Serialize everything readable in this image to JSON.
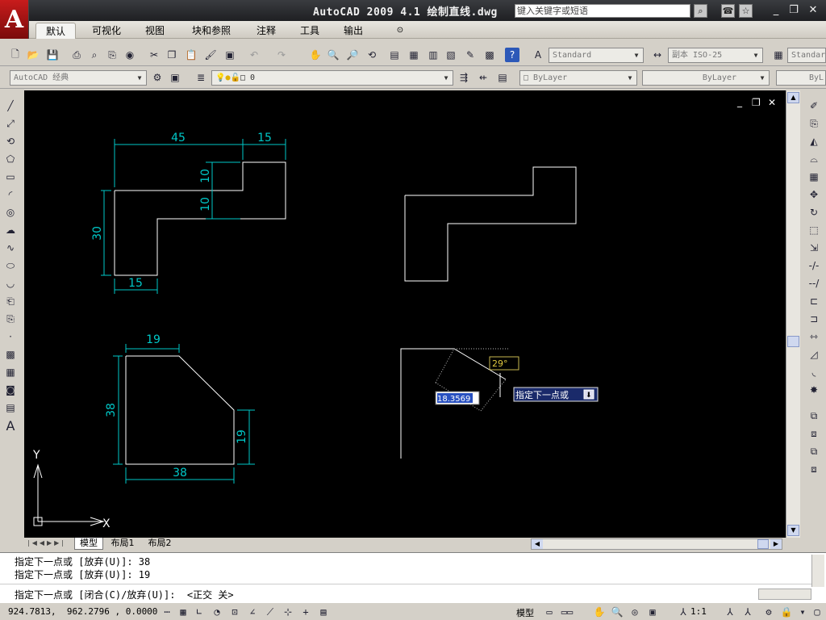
{
  "window": {
    "title": "AutoCAD 2009 4.1 绘制直线.dwg",
    "logo_letter": "A",
    "search_placeholder": "键入关键字或短语",
    "minimize": "_",
    "restore": "❐",
    "close": "✕"
  },
  "ribbon_tabs": [
    {
      "label": "默认",
      "active": true
    },
    {
      "label": "可视化",
      "active": false
    },
    {
      "label": "视图",
      "active": false
    },
    {
      "label": "块和参照",
      "active": false
    },
    {
      "label": "注释",
      "active": false
    },
    {
      "label": "工具",
      "active": false
    },
    {
      "label": "输出",
      "active": false
    }
  ],
  "toolbar": {
    "text_style": "Standard",
    "dim_style": "副本 ISO-25",
    "table_style": "Standar",
    "workspace": "AutoCAD 经典",
    "layer": "0",
    "color": "ByLayer",
    "linetype": "ByLayer",
    "lineweight": "ByL"
  },
  "drawing": {
    "dims_shape1": [
      "45",
      "15",
      "10",
      "10",
      "30",
      "15"
    ],
    "dims_shape3": [
      "19",
      "38",
      "19",
      "38"
    ],
    "angle_tooltip": "29°",
    "length_input": "18.3569",
    "prompt_tooltip": "指定下一点或",
    "ucs_x": "X",
    "ucs_y": "Y",
    "viewport_min": "_",
    "viewport_restore": "❐",
    "viewport_close": "✕"
  },
  "layout_tabs": [
    "模型",
    "布局1",
    "布局2"
  ],
  "command_history": [
    "指定下一点或 [放弃(U)]: 38",
    "指定下一点或 [放弃(U)]: 19",
    "指定下一点或 [闭合(C)/放弃(U)]:  <正交 关>"
  ],
  "status": {
    "coordinates": "924.7813,  962.2796 , 0.0000",
    "model_label": "模型",
    "scale": "1:1"
  }
}
